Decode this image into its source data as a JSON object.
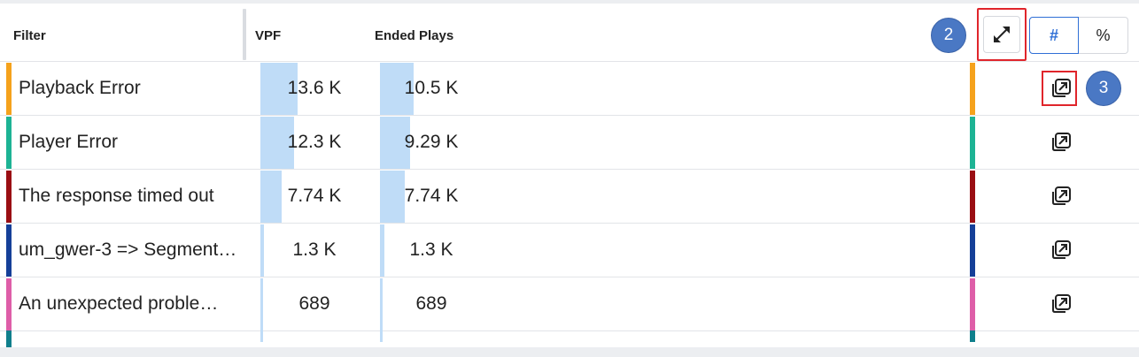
{
  "header": {
    "filter_label": "Filter",
    "vpf_label": "VPF",
    "ended_label": "Ended Plays",
    "expand_badge": "2",
    "toggle_count": "#",
    "toggle_percent": "%"
  },
  "rows": [
    {
      "name": "Playback Error",
      "vpf": "13.6 K",
      "ended": "10.5 K",
      "vpf_fraction": 1.0,
      "ended_fraction": 1.0,
      "color": "#f5a21c",
      "badge": "3"
    },
    {
      "name": "Player Error",
      "vpf": "12.3 K",
      "ended": "9.29 K",
      "vpf_fraction": 0.905,
      "ended_fraction": 0.885,
      "color": "#1db394"
    },
    {
      "name": "The response timed out",
      "vpf": "7.74 K",
      "ended": "7.74 K",
      "vpf_fraction": 0.57,
      "ended_fraction": 0.737,
      "color": "#9a0e13"
    },
    {
      "name": "um_gwer-3 => Segment…",
      "vpf": "1.3 K",
      "ended": "1.3 K",
      "vpf_fraction": 0.096,
      "ended_fraction": 0.124,
      "color": "#153f98"
    },
    {
      "name": "An unexpected proble…",
      "vpf": "689",
      "ended": "689",
      "vpf_fraction": 0.051,
      "ended_fraction": 0.066,
      "color": "#de5ea8"
    }
  ],
  "partial_row_color": "#0f7f8c",
  "icons": {
    "expand": "expand-arrows-icon",
    "open": "open-in-new-icon"
  }
}
